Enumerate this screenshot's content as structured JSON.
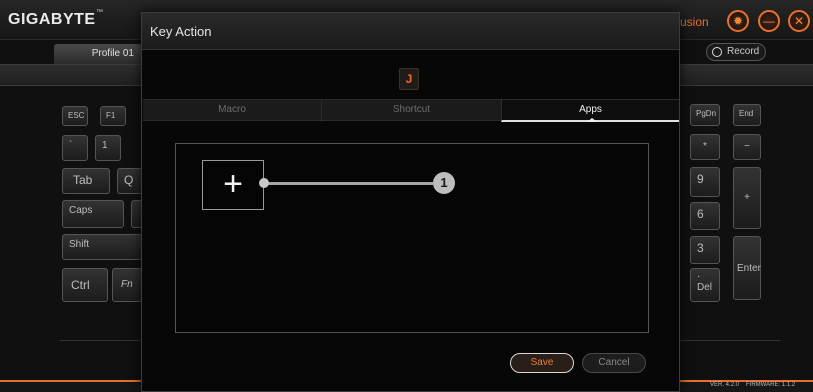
{
  "app": {
    "brand": "GIGABYTE",
    "brand_tm": "™",
    "name_tail": "usion",
    "buttons": {
      "settings_icon": "gear-icon",
      "minimize_icon": "minimize-icon",
      "close_icon": "close-icon"
    }
  },
  "toolbar": {
    "profile_label": "Profile 01",
    "record_label": "Record"
  },
  "keyboard": {
    "left_keys": [
      "ESC",
      "F1",
      "`",
      "1",
      "Tab",
      "Q",
      "Caps",
      "Shift",
      "Ctrl",
      "Fn"
    ],
    "right_keys": [
      "PgDn",
      "End",
      "*",
      "−",
      "9",
      "+",
      "6",
      "3",
      "Enter",
      "·",
      "Del"
    ]
  },
  "status": {
    "version": "VER. 4.2.0",
    "firmware": "FIRMWARE: 1.1.2"
  },
  "dialog": {
    "title": "Key Action",
    "selected_key": "J",
    "tabs": [
      {
        "label": "Macro",
        "active": false
      },
      {
        "label": "Shortcut",
        "active": false
      },
      {
        "label": "Apps",
        "active": true
      }
    ],
    "add_app_symbol": "+",
    "callout_number": "1",
    "save_label": "Save",
    "cancel_label": "Cancel"
  },
  "colors": {
    "accent": "#e8702a",
    "background": "#101010",
    "dialog_bg": "#070707"
  }
}
